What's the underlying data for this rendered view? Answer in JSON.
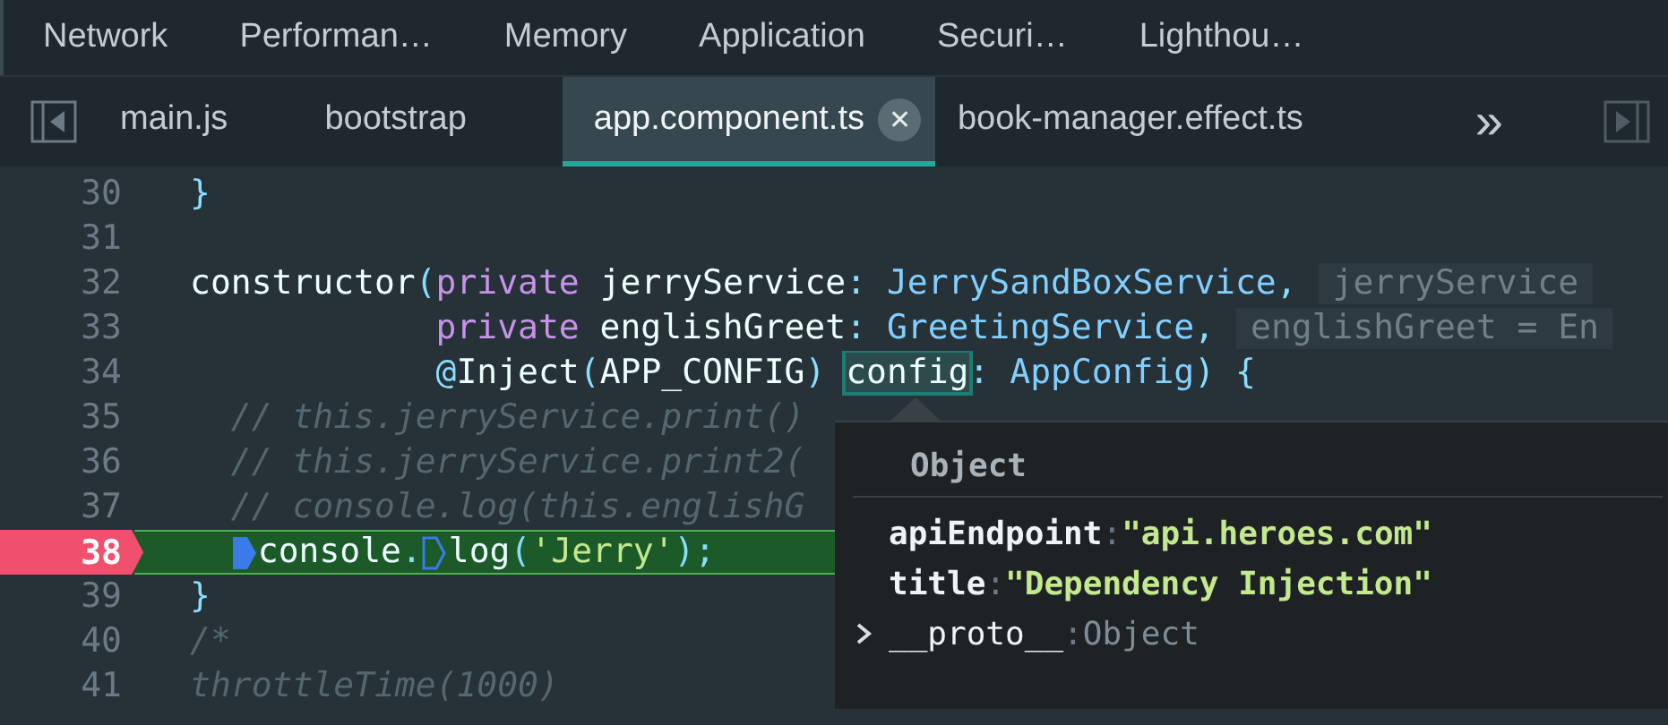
{
  "panel_tabs": [
    {
      "label": "Network"
    },
    {
      "label": "Performan…"
    },
    {
      "label": "Memory"
    },
    {
      "label": "Application"
    },
    {
      "label": "Securi…"
    },
    {
      "label": "Lighthou…"
    }
  ],
  "file_tabs": [
    {
      "label": "main.js",
      "selected": false
    },
    {
      "label": "bootstrap",
      "selected": false
    },
    {
      "label": "app.component.ts",
      "selected": true,
      "close": "✕"
    },
    {
      "label": "book-manager.effect.ts",
      "selected": false
    }
  ],
  "more_tabs": "»",
  "lines": [
    {
      "number": "30",
      "breakpoint": false,
      "current": false,
      "segments": [
        {
          "kind": "code",
          "tokens": [
            {
              "kind": "punct",
              "text": "}"
            }
          ]
        }
      ]
    },
    {
      "number": "31",
      "breakpoint": false,
      "current": false
    },
    {
      "number": "32",
      "breakpoint": false,
      "current": false,
      "segments": [
        {
          "kind": "code",
          "tokens": [
            {
              "kind": "plain",
              "text": "constructor"
            },
            {
              "kind": "punct",
              "text": "("
            },
            {
              "kind": "keyword",
              "text": "private"
            },
            {
              "kind": "plain",
              "text": " jerryService"
            },
            {
              "kind": "punct",
              "text": ":"
            },
            {
              "kind": "type",
              "text": " JerrySandBoxService"
            },
            {
              "kind": "punct",
              "text": ","
            }
          ]
        },
        {
          "kind": "hint",
          "text": "jerryService"
        }
      ]
    },
    {
      "number": "33",
      "breakpoint": false,
      "current": false,
      "segments": [
        {
          "kind": "code",
          "tokens": [
            {
              "kind": "keyword",
              "text": "            private"
            },
            {
              "kind": "plain",
              "text": " englishGreet"
            },
            {
              "kind": "punct",
              "text": ":"
            },
            {
              "kind": "type",
              "text": " GreetingService"
            },
            {
              "kind": "punct",
              "text": ","
            }
          ]
        },
        {
          "kind": "hint",
          "text": "englishGreet = En"
        }
      ]
    },
    {
      "number": "34",
      "breakpoint": false,
      "current": false,
      "segments": [
        {
          "kind": "code",
          "tokens": [
            {
              "kind": "punct",
              "text": "            @"
            },
            {
              "kind": "plain",
              "text": "Inject"
            },
            {
              "kind": "punct",
              "text": "("
            },
            {
              "kind": "plain",
              "text": "APP_CONFIG"
            },
            {
              "kind": "punct",
              "text": ") "
            },
            {
              "kind": "hover",
              "text": "config"
            },
            {
              "kind": "punct",
              "text": ": "
            },
            {
              "kind": "type",
              "text": "AppConfig"
            },
            {
              "kind": "punct",
              "text": ") {"
            }
          ]
        }
      ]
    },
    {
      "number": "35",
      "breakpoint": false,
      "current": false,
      "segments": [
        {
          "kind": "code",
          "tokens": [
            {
              "kind": "comment",
              "text": "  // this.jerryService.print()"
            }
          ]
        }
      ]
    },
    {
      "number": "36",
      "breakpoint": false,
      "current": false,
      "segments": [
        {
          "kind": "code",
          "tokens": [
            {
              "kind": "comment",
              "text": "  // this.jerryService.print2("
            }
          ]
        }
      ]
    },
    {
      "number": "37",
      "breakpoint": false,
      "current": false,
      "segments": [
        {
          "kind": "code",
          "tokens": [
            {
              "kind": "comment",
              "text": "  // console.log(this.englishG"
            }
          ]
        }
      ]
    },
    {
      "number": "38",
      "breakpoint": true,
      "current": true,
      "segments": [
        {
          "kind": "marker",
          "active": true
        },
        {
          "kind": "code",
          "tokens": [
            {
              "kind": "plain",
              "text": "console"
            },
            {
              "kind": "punct",
              "text": "."
            }
          ]
        },
        {
          "kind": "marker",
          "active": false
        },
        {
          "kind": "code",
          "tokens": [
            {
              "kind": "plain",
              "text": "log"
            },
            {
              "kind": "punct",
              "text": "("
            },
            {
              "kind": "string",
              "text": "'Jerry'"
            },
            {
              "kind": "punct",
              "text": ");"
            }
          ]
        }
      ]
    },
    {
      "number": "39",
      "breakpoint": false,
      "current": false,
      "segments": [
        {
          "kind": "code",
          "tokens": [
            {
              "kind": "punct",
              "text": "}"
            }
          ]
        }
      ]
    },
    {
      "number": "40",
      "breakpoint": false,
      "current": false,
      "segments": [
        {
          "kind": "code",
          "tokens": [
            {
              "kind": "comment",
              "text": "/*"
            }
          ]
        }
      ]
    },
    {
      "number": "41",
      "breakpoint": false,
      "current": false,
      "segments": [
        {
          "kind": "code",
          "tokens": [
            {
              "kind": "comment",
              "text": "throttleTime(1000)"
            }
          ]
        }
      ]
    }
  ],
  "popover": {
    "header": "Object",
    "properties": [
      {
        "key": "apiEndpoint",
        "separator": ":",
        "value": "\"api.heroes.com\"",
        "kind": "string"
      },
      {
        "key": "title",
        "separator": ":",
        "value": "\"Dependency Injection\"",
        "kind": "string"
      },
      {
        "key": "__proto__",
        "separator": ":",
        "value": "Object",
        "kind": "object",
        "expanded": false
      }
    ]
  }
}
